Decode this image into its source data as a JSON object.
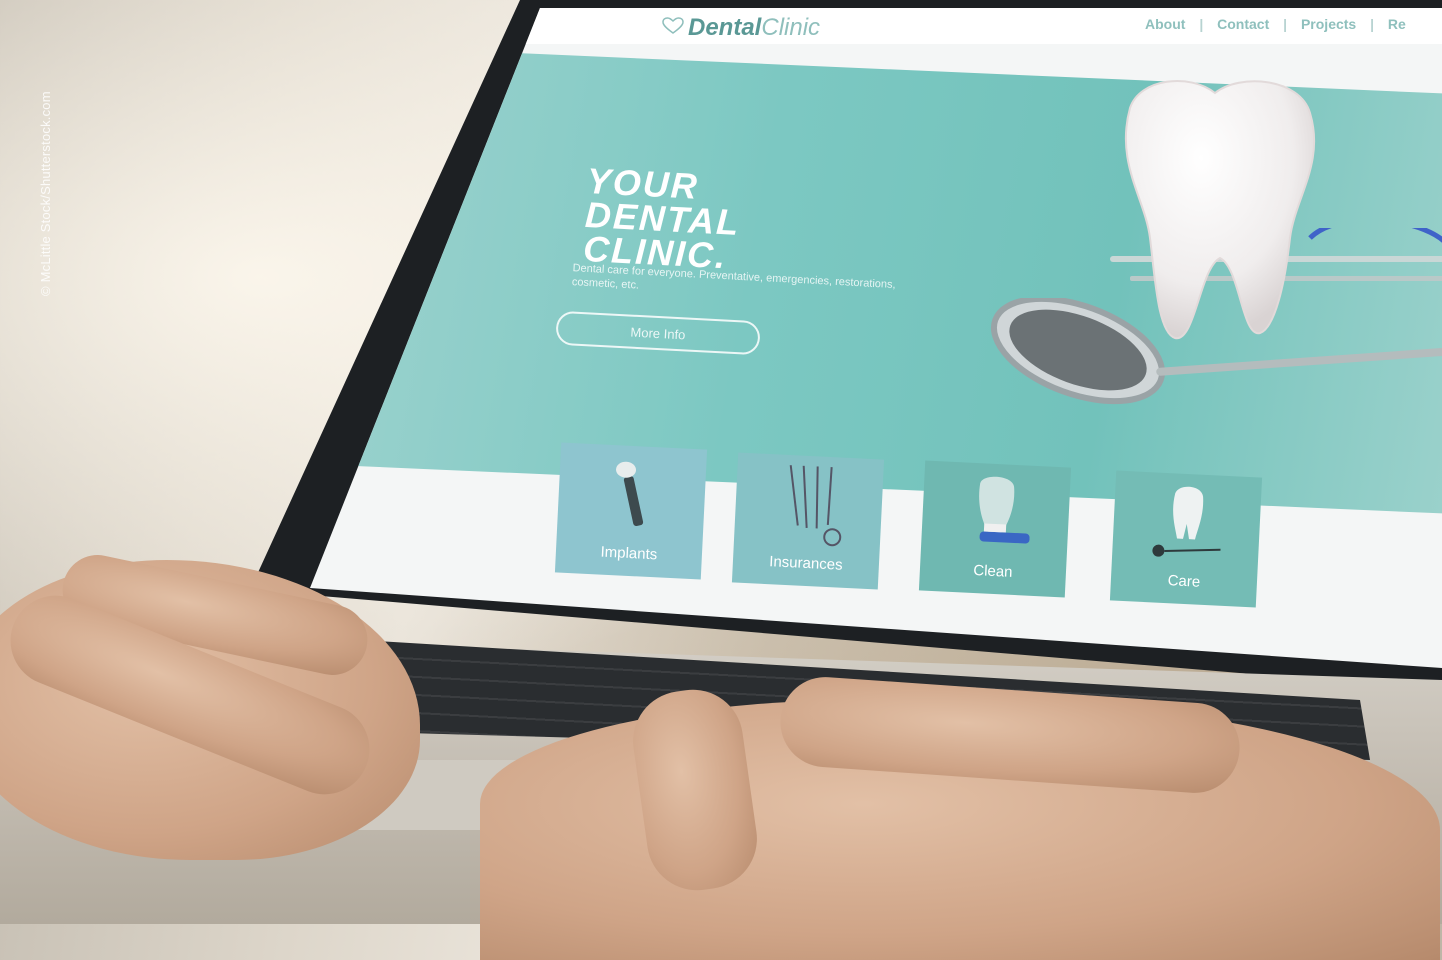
{
  "credit": "© McLittle Stock/Shutterstock.com",
  "site": {
    "logo_bold": "Dental",
    "logo_thin": "Clinic",
    "nav": [
      "About",
      "|",
      "Contact",
      "|",
      "Projects",
      "|",
      "Re"
    ]
  },
  "hero": {
    "title_lines": [
      "YOUR",
      "DENTAL",
      "CLINIC."
    ],
    "subtitle": "Dental care for everyone. Preventative, emergencies, restorations, cosmetic, etc.",
    "button_label": "More Info"
  },
  "tiles": [
    "Implants",
    "Insurances",
    "Clean",
    "Care"
  ],
  "colors": {
    "hero": "#7cc8c2",
    "tile_blue": "#8ec5cf",
    "tile_teal": "#6fb8b1",
    "logo": "#5a9895"
  }
}
